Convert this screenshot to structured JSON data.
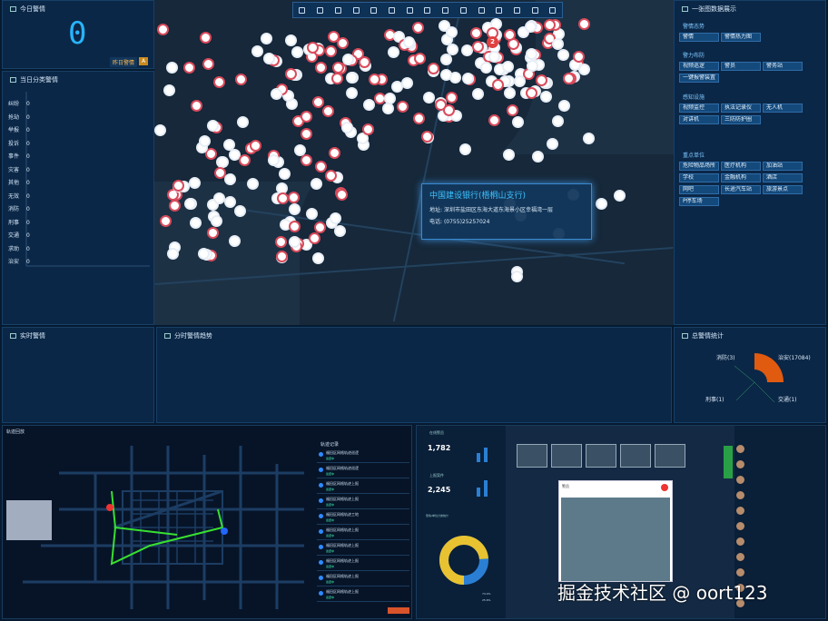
{
  "left": {
    "today_title": "今日警情",
    "today_count": "0",
    "yesterday_label": "昨日警情",
    "yesterday_badge": "A",
    "categories_title": "当日分类警情",
    "categories": [
      {
        "name": "纠纷",
        "value": "0"
      },
      {
        "name": "抢劫",
        "value": "0"
      },
      {
        "name": "举报",
        "value": "0"
      },
      {
        "name": "投诉",
        "value": "0"
      },
      {
        "name": "事件",
        "value": "0"
      },
      {
        "name": "灾害",
        "value": "0"
      },
      {
        "name": "其他",
        "value": "0"
      },
      {
        "name": "无效",
        "value": "0"
      },
      {
        "name": "消防",
        "value": "0"
      },
      {
        "name": "刑事",
        "value": "0"
      },
      {
        "name": "交通",
        "value": "0"
      },
      {
        "name": "求助",
        "value": "0"
      },
      {
        "name": "治安",
        "value": "0"
      }
    ]
  },
  "map": {
    "popup": {
      "name": "中国建设银行(梧桐山支行)",
      "address_label": "地址:",
      "address": "深圳市盐田区东海大道东海景小区幸福湾一层",
      "phone_label": "电话:",
      "phone": "(0755)25257024"
    },
    "cluster": "2"
  },
  "right": {
    "title": "一张图数据展示",
    "sections": [
      {
        "name": "警情态势",
        "chips": [
          "警情",
          "警情热力图"
        ]
      },
      {
        "name": "警力布防",
        "chips": [
          "视频巡逻",
          "警员",
          "警务站",
          "一键报警装置"
        ]
      },
      {
        "name": "感知设施",
        "chips": [
          "视频监控",
          "执法记录仪",
          "无人机",
          "对讲机",
          "三防防护圈"
        ]
      },
      {
        "name": "重点单位",
        "chips": [
          "危险物品场所",
          "医疗机构",
          "加油站",
          "学校",
          "金融机构",
          "酒店",
          "网吧",
          "长途汽车站",
          "旅游景点",
          "P停车场"
        ]
      }
    ]
  },
  "bottom": {
    "realtime_title": "实时警情",
    "trend_title": "分时警情趋势",
    "total_title": "总警情统计",
    "pie": {
      "labels": [
        "治安(17084)",
        "消防(3)",
        "刑事(1)",
        "交通(1)"
      ],
      "values": [
        17084,
        3,
        1,
        1
      ]
    }
  },
  "track": {
    "title": "轨迹回放",
    "records_title": "轨迹记录",
    "records": [
      {
        "name": "福田区网格轨迹巡逻",
        "status": "巡逻中"
      },
      {
        "name": "福田区网格轨迹巡逻",
        "status": "巡逻中"
      },
      {
        "name": "福田区网格轨迹上报",
        "status": "巡逻中"
      },
      {
        "name": "福田区网格轨迹上报",
        "status": "巡逻中"
      },
      {
        "name": "福田区网格轨迹工地",
        "status": "巡逻中"
      },
      {
        "name": "福田区网格轨迹上报",
        "status": "巡逻中"
      },
      {
        "name": "福田区网格轨迹上报",
        "status": "巡逻中"
      },
      {
        "name": "福田区网格轨迹上报",
        "status": "巡逻中"
      },
      {
        "name": "福田区网格轨迹上报",
        "status": "巡逻中"
      },
      {
        "name": "福田区网格轨迹上报",
        "status": "巡逻中"
      }
    ]
  },
  "dash": {
    "stat1_title": "在线警员",
    "stat1": "1,782",
    "stat2_title": "上报案件",
    "stat2": "2,245",
    "donut_title": "警情/单位分类统计",
    "window_title": "警员",
    "legend": [
      "74.4%",
      "25.6%"
    ]
  },
  "watermark": "掘金技术社区 @ oort123"
}
